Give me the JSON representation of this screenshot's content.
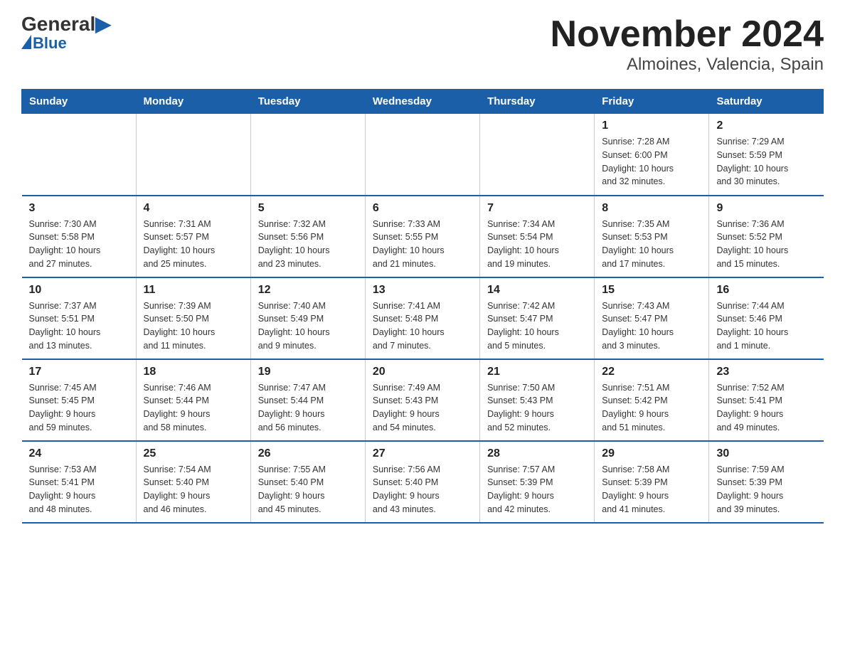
{
  "header": {
    "logo_general": "General",
    "logo_blue": "Blue",
    "title": "November 2024",
    "subtitle": "Almoines, Valencia, Spain"
  },
  "days_of_week": [
    "Sunday",
    "Monday",
    "Tuesday",
    "Wednesday",
    "Thursday",
    "Friday",
    "Saturday"
  ],
  "weeks": [
    [
      {
        "day": "",
        "info": ""
      },
      {
        "day": "",
        "info": ""
      },
      {
        "day": "",
        "info": ""
      },
      {
        "day": "",
        "info": ""
      },
      {
        "day": "",
        "info": ""
      },
      {
        "day": "1",
        "info": "Sunrise: 7:28 AM\nSunset: 6:00 PM\nDaylight: 10 hours\nand 32 minutes."
      },
      {
        "day": "2",
        "info": "Sunrise: 7:29 AM\nSunset: 5:59 PM\nDaylight: 10 hours\nand 30 minutes."
      }
    ],
    [
      {
        "day": "3",
        "info": "Sunrise: 7:30 AM\nSunset: 5:58 PM\nDaylight: 10 hours\nand 27 minutes."
      },
      {
        "day": "4",
        "info": "Sunrise: 7:31 AM\nSunset: 5:57 PM\nDaylight: 10 hours\nand 25 minutes."
      },
      {
        "day": "5",
        "info": "Sunrise: 7:32 AM\nSunset: 5:56 PM\nDaylight: 10 hours\nand 23 minutes."
      },
      {
        "day": "6",
        "info": "Sunrise: 7:33 AM\nSunset: 5:55 PM\nDaylight: 10 hours\nand 21 minutes."
      },
      {
        "day": "7",
        "info": "Sunrise: 7:34 AM\nSunset: 5:54 PM\nDaylight: 10 hours\nand 19 minutes."
      },
      {
        "day": "8",
        "info": "Sunrise: 7:35 AM\nSunset: 5:53 PM\nDaylight: 10 hours\nand 17 minutes."
      },
      {
        "day": "9",
        "info": "Sunrise: 7:36 AM\nSunset: 5:52 PM\nDaylight: 10 hours\nand 15 minutes."
      }
    ],
    [
      {
        "day": "10",
        "info": "Sunrise: 7:37 AM\nSunset: 5:51 PM\nDaylight: 10 hours\nand 13 minutes."
      },
      {
        "day": "11",
        "info": "Sunrise: 7:39 AM\nSunset: 5:50 PM\nDaylight: 10 hours\nand 11 minutes."
      },
      {
        "day": "12",
        "info": "Sunrise: 7:40 AM\nSunset: 5:49 PM\nDaylight: 10 hours\nand 9 minutes."
      },
      {
        "day": "13",
        "info": "Sunrise: 7:41 AM\nSunset: 5:48 PM\nDaylight: 10 hours\nand 7 minutes."
      },
      {
        "day": "14",
        "info": "Sunrise: 7:42 AM\nSunset: 5:47 PM\nDaylight: 10 hours\nand 5 minutes."
      },
      {
        "day": "15",
        "info": "Sunrise: 7:43 AM\nSunset: 5:47 PM\nDaylight: 10 hours\nand 3 minutes."
      },
      {
        "day": "16",
        "info": "Sunrise: 7:44 AM\nSunset: 5:46 PM\nDaylight: 10 hours\nand 1 minute."
      }
    ],
    [
      {
        "day": "17",
        "info": "Sunrise: 7:45 AM\nSunset: 5:45 PM\nDaylight: 9 hours\nand 59 minutes."
      },
      {
        "day": "18",
        "info": "Sunrise: 7:46 AM\nSunset: 5:44 PM\nDaylight: 9 hours\nand 58 minutes."
      },
      {
        "day": "19",
        "info": "Sunrise: 7:47 AM\nSunset: 5:44 PM\nDaylight: 9 hours\nand 56 minutes."
      },
      {
        "day": "20",
        "info": "Sunrise: 7:49 AM\nSunset: 5:43 PM\nDaylight: 9 hours\nand 54 minutes."
      },
      {
        "day": "21",
        "info": "Sunrise: 7:50 AM\nSunset: 5:43 PM\nDaylight: 9 hours\nand 52 minutes."
      },
      {
        "day": "22",
        "info": "Sunrise: 7:51 AM\nSunset: 5:42 PM\nDaylight: 9 hours\nand 51 minutes."
      },
      {
        "day": "23",
        "info": "Sunrise: 7:52 AM\nSunset: 5:41 PM\nDaylight: 9 hours\nand 49 minutes."
      }
    ],
    [
      {
        "day": "24",
        "info": "Sunrise: 7:53 AM\nSunset: 5:41 PM\nDaylight: 9 hours\nand 48 minutes."
      },
      {
        "day": "25",
        "info": "Sunrise: 7:54 AM\nSunset: 5:40 PM\nDaylight: 9 hours\nand 46 minutes."
      },
      {
        "day": "26",
        "info": "Sunrise: 7:55 AM\nSunset: 5:40 PM\nDaylight: 9 hours\nand 45 minutes."
      },
      {
        "day": "27",
        "info": "Sunrise: 7:56 AM\nSunset: 5:40 PM\nDaylight: 9 hours\nand 43 minutes."
      },
      {
        "day": "28",
        "info": "Sunrise: 7:57 AM\nSunset: 5:39 PM\nDaylight: 9 hours\nand 42 minutes."
      },
      {
        "day": "29",
        "info": "Sunrise: 7:58 AM\nSunset: 5:39 PM\nDaylight: 9 hours\nand 41 minutes."
      },
      {
        "day": "30",
        "info": "Sunrise: 7:59 AM\nSunset: 5:39 PM\nDaylight: 9 hours\nand 39 minutes."
      }
    ]
  ]
}
